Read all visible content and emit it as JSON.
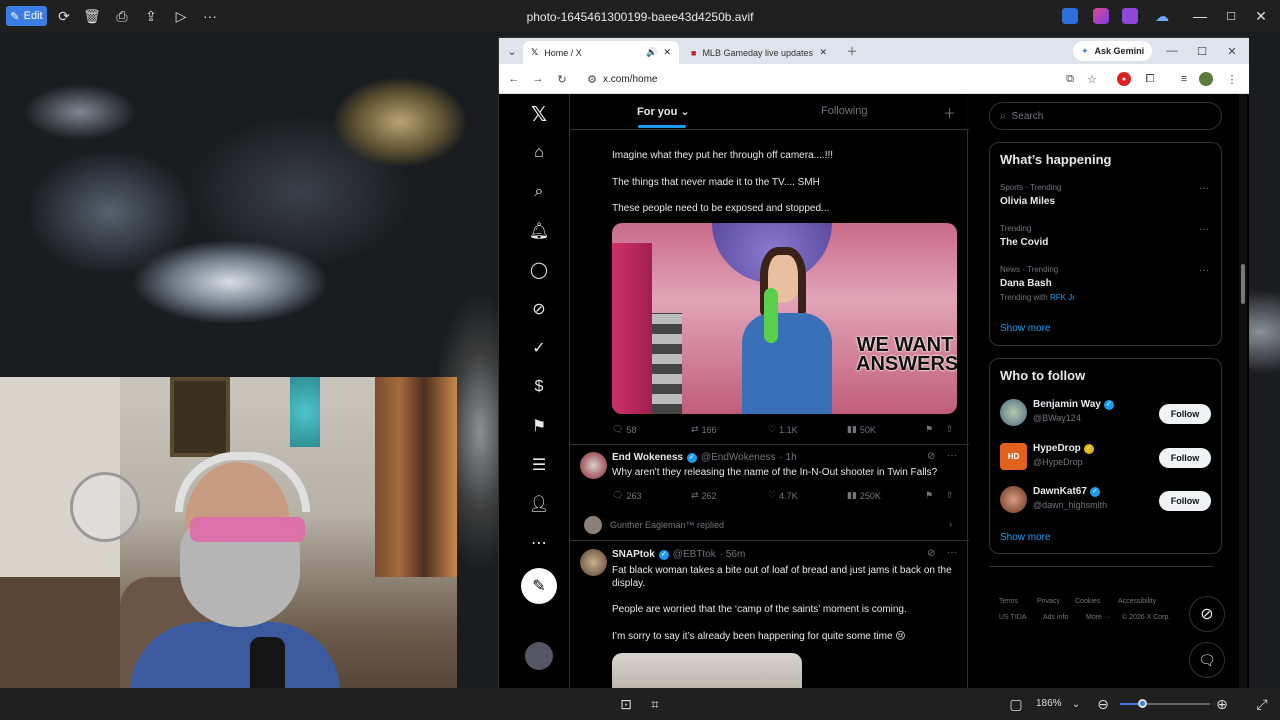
{
  "viewer": {
    "edit_label": "Edit",
    "file_title": "photo-1645461300199-baee43d4250b.avif",
    "zoom": "186%"
  },
  "browser": {
    "tab_active_title": "Home / X",
    "tab_inactive_title": "MLB Gameday live updates: Pir",
    "ask_gemini": "Ask Gemini",
    "url": "x.com/home"
  },
  "timeline": {
    "tab_for_you": "For you",
    "tab_following": "Following",
    "tweet1": {
      "line1": "Imagine what they put her through off camera....!!!",
      "line2": "The things that never made it to the TV.... SMH",
      "line3": "These people need to be exposed and stopped...",
      "image_caption": "WE WANT ANSWERS",
      "replies": "58",
      "reposts": "166",
      "likes": "1.1K",
      "views": "50K"
    },
    "tweet2": {
      "name": "End Wokeness",
      "handle": "@EndWokeness",
      "time": "· 1h",
      "text": "Why aren't they releasing the name of the In-N-Out shooter in Twin Falls?",
      "replies": "263",
      "reposts": "262",
      "likes": "4.7K",
      "views": "250K",
      "replied_by": "Gunther Eagleman™ replied"
    },
    "tweet3": {
      "name": "SNAPtok",
      "handle": "@EBTtok",
      "time": "· 56m",
      "text1": "Fat black woman takes a bite out of loaf of bread and just jams it back on the display.",
      "text2": "People are worried that the ‘camp of the saints’ moment is coming.",
      "text3": "I’m sorry to say it’s already been happening for quite some time 😢"
    }
  },
  "sidebar": {
    "search_placeholder": "Search",
    "whats_happening": "What’s happening",
    "trends": [
      {
        "meta": "Sports · Trending",
        "name": "Olivia Miles"
      },
      {
        "meta": "Trending",
        "name": "The Covid"
      },
      {
        "meta": "News · Trending",
        "name": "Dana Bash",
        "extra_prefix": "Trending with",
        "extra_link": "RFK Jr"
      }
    ],
    "show_more": "Show more",
    "who_to_follow": "Who to follow",
    "follow_suggestions": [
      {
        "name": "Benjamin Way",
        "handle": "@BWay124",
        "verified": "blue"
      },
      {
        "name": "HypeDrop",
        "handle": "@HypeDrop",
        "verified": "gold"
      },
      {
        "name": "DawnKat67",
        "handle": "@dawn_highsmith",
        "verified": "blue"
      }
    ],
    "follow_label": "Follow",
    "show_more_2": "Show more",
    "footer": [
      "Terms",
      "Privacy",
      "Cookies",
      "Accessibility",
      "US TIDA",
      "Ads info",
      "More ···",
      "© 2026 X Corp."
    ]
  },
  "colors": {
    "accent": "#1d9bf0",
    "background": "#000000",
    "text": "#e7e9ea",
    "muted": "#71767b",
    "edit_button": "#3b7de4"
  }
}
